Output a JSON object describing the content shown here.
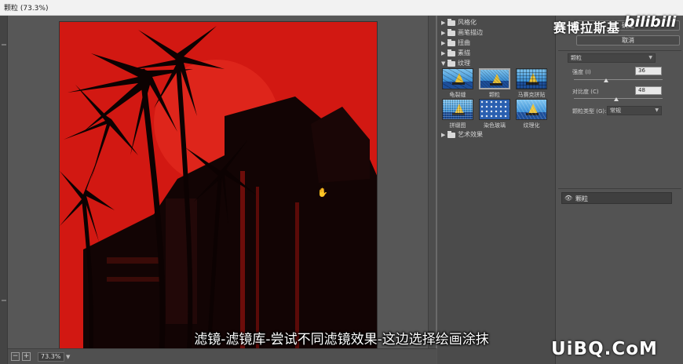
{
  "window": {
    "title": "颗粒 (73.3%)"
  },
  "canvas": {
    "cursor_icon": "hand-icon"
  },
  "statusbar": {
    "zoom": "73.3%",
    "zoom_out_icon": "minus-icon",
    "zoom_in_icon": "plus-icon"
  },
  "gallery": {
    "folders_top": [
      {
        "label": "风格化",
        "expanded": false
      },
      {
        "label": "画笔描边",
        "expanded": false
      },
      {
        "label": "扭曲",
        "expanded": false
      },
      {
        "label": "素描",
        "expanded": false
      },
      {
        "label": "纹理",
        "expanded": true
      }
    ],
    "thumbnails": [
      {
        "label": "龟裂缝",
        "selected": false
      },
      {
        "label": "颗粒",
        "selected": true
      },
      {
        "label": "马赛克拼贴",
        "selected": false
      },
      {
        "label": "拼缀图",
        "selected": false
      },
      {
        "label": "染色玻璃",
        "selected": false
      },
      {
        "label": "纹理化",
        "selected": false
      }
    ],
    "folders_bottom": [
      {
        "label": "艺术效果",
        "expanded": false
      }
    ]
  },
  "panel": {
    "ok_label": "确定",
    "cancel_label": "取消",
    "filter_select": "颗粒",
    "intensity_label": "强度 (I)",
    "intensity_value": "36",
    "intensity_level": 0.36,
    "contrast_label": "对比度 (C)",
    "contrast_value": "48",
    "contrast_level": 0.48,
    "grain_type_label": "颗粒类型 (G):",
    "grain_type_value": "常规",
    "layer_name": "颗粒"
  },
  "overlay": {
    "brand_name": "赛博拉斯基",
    "brand_logo": "bilibili",
    "subtitle": "滤镜-滤镜库-尝试不同滤镜效果-这边选择绘画涂抹",
    "watermark": "UiBQ.CoM"
  },
  "colors": {
    "canvas_red": "#d21812",
    "panel_bg": "#535353",
    "gallery_bg": "#4b4b4b"
  }
}
